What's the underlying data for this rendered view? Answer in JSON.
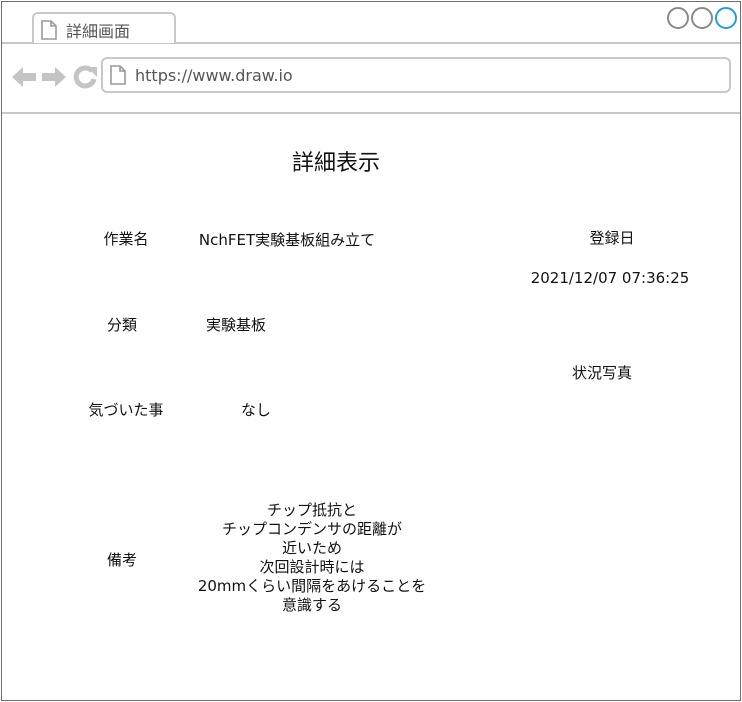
{
  "browser": {
    "tab_title": "詳細画面",
    "url": "https://www.draw.io",
    "accent_color": "#1e9de6"
  },
  "page": {
    "title": "詳細表示",
    "fields": {
      "task_name_label": "作業名",
      "task_name_value": "NchFET実験基板組み立て",
      "registered_label": "登録日",
      "registered_value": "2021/12/07 07:36:25",
      "category_label": "分類",
      "category_value": "実験基板",
      "photo_label": "状況写真",
      "notice_label": "気づいた事",
      "notice_value": "なし",
      "remarks_label": "備考",
      "remarks_lines": [
        "チップ抵抗と",
        "チップコンデンサの距離が",
        "近いため",
        "次回設計時には",
        "20mmくらい間隔をあけることを",
        "意識する"
      ]
    }
  }
}
